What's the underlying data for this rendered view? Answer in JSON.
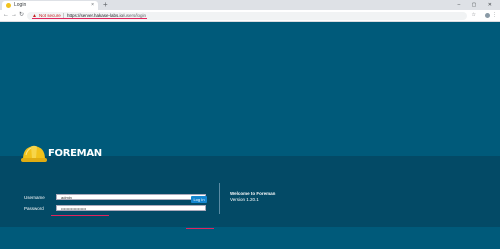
{
  "browser": {
    "tab_title": "Login",
    "tab_close": "×",
    "new_tab": "+",
    "window_controls": "– ▢ ✕",
    "nav_back": "←",
    "nav_forward": "→",
    "nav_reload": "↻",
    "security_warning": "Not secure",
    "url_scheme": "https://",
    "url_host": "server.hakase-labs.io",
    "url_path": "/users/login",
    "star": "☆",
    "menu": "⋮"
  },
  "brand": {
    "name": "FOREMAN",
    "helmet_color": "#f2c21b"
  },
  "login": {
    "username_label": "Username",
    "username_value": "admin",
    "password_label": "Password",
    "password_value": "••••••••••••••••••",
    "submit_label": "Log In"
  },
  "welcome": {
    "title": "Welcome to Foreman",
    "version": "Version 1.20.1"
  },
  "colors": {
    "background": "#005a7a",
    "panel": "#034a66",
    "button": "#1386d0",
    "annotation": "#e0245e"
  }
}
